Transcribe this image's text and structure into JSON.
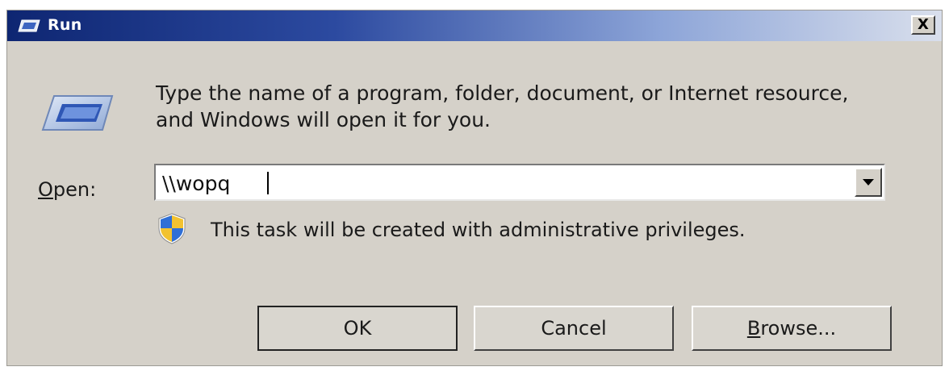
{
  "window": {
    "title": "Run",
    "close_label": "X",
    "title_icon": "run-icon"
  },
  "dialog": {
    "icon": "run-icon",
    "description": "Type the name of a program, folder, document, or Internet resource, and Windows will open it for you.",
    "open_label_mnemonic": "O",
    "open_label_rest": "pen:",
    "open_value": "\\\\wopq",
    "admin_icon": "uac-shield-icon",
    "admin_notice": "This task will be created with administrative privileges."
  },
  "buttons": {
    "ok": "OK",
    "cancel": "Cancel",
    "browse_mnemonic": "B",
    "browse_rest": "rowse..."
  },
  "colors": {
    "title_gradient_start": "#0e2672",
    "title_gradient_end": "#d9dfec",
    "dialog_face": "#d5d1c9"
  }
}
